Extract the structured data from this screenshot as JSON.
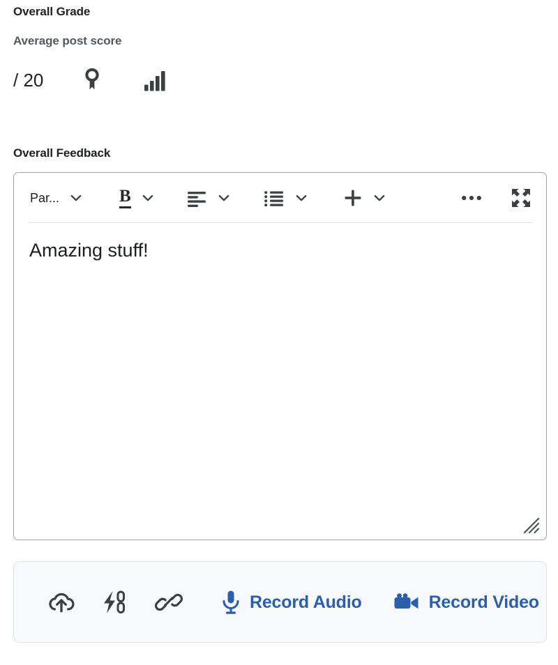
{
  "grade": {
    "section_title": "Overall Grade",
    "subtitle": "Average post score",
    "score_value": "",
    "score_placeholder": "",
    "denominator": "/ 20",
    "rubric_icon": "award-ribbon-icon",
    "statistics_icon": "bar-chart-icon"
  },
  "feedback": {
    "section_title": "Overall Feedback",
    "editor": {
      "toolbar": {
        "paragraph_label": "Par...",
        "paragraph_chevron_icon": "chevron-down-icon",
        "bold_label": "B",
        "bold_chevron_icon": "chevron-down-icon",
        "align_icon": "align-left-icon",
        "align_chevron_icon": "chevron-down-icon",
        "list_icon": "bulleted-list-icon",
        "list_chevron_icon": "chevron-down-icon",
        "insert_icon": "plus-icon",
        "insert_chevron_icon": "chevron-down-icon",
        "more_icon": "ellipsis-icon",
        "fullscreen_icon": "expand-fullscreen-icon"
      },
      "content": "Amazing stuff!",
      "resize_icon": "resize-grip-icon"
    }
  },
  "attachments": {
    "upload_icon": "cloud-upload-icon",
    "quicklink_icon": "quicklink-icon",
    "link_icon": "chain-link-icon",
    "record_audio": {
      "icon": "microphone-icon",
      "label": "Record Audio"
    },
    "record_video": {
      "icon": "video-camera-icon",
      "label": "Record Video"
    }
  },
  "colors": {
    "link_blue": "#2b5fac",
    "icon_gray": "#3b4045",
    "text_primary": "#202122",
    "text_secondary": "#53595d",
    "panel_bg": "#f7f9fc",
    "border": "#9ea2a6"
  }
}
